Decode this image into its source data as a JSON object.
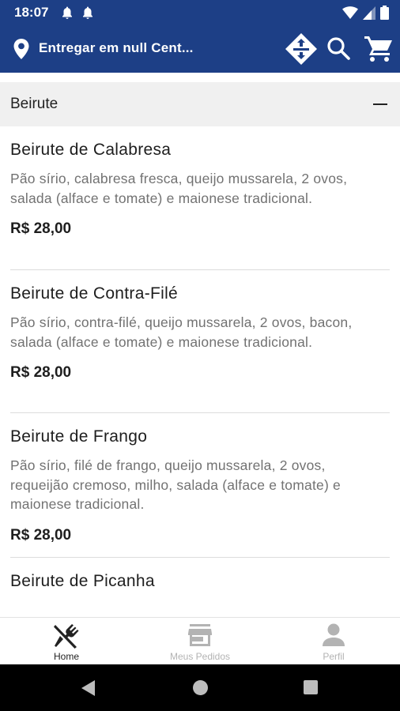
{
  "status_bar": {
    "time": "18:07",
    "icons": [
      "notification-bell-icon",
      "notification-bell-icon",
      "wifi-icon",
      "signal-icon",
      "battery-icon"
    ]
  },
  "app_bar": {
    "location_label": "Entregar em null Cent...",
    "icons": [
      "location-pin-icon",
      "route-directions-icon",
      "search-icon",
      "cart-icon"
    ],
    "background_color": "#1d3f86"
  },
  "category": {
    "title": "Beirute",
    "toggle": "collapse-minus-icon"
  },
  "menu_items": [
    {
      "name": "Beirute de Calabresa",
      "description": "Pão sírio, calabresa fresca, queijo mussarela, 2 ovos, salada (alface e tomate) e maionese tradicional.",
      "price": "R$ 28,00"
    },
    {
      "name": "Beirute de Contra-Filé",
      "description": "Pão sírio, contra-filé, queijo mussarela, 2 ovos, bacon, salada (alface e tomate) e maionese tradicional.",
      "price": "R$ 28,00"
    },
    {
      "name": "Beirute de Frango",
      "description": "Pão sírio, filé de frango, queijo mussarela, 2 ovos, requeijão cremoso, milho, salada (alface e tomate) e maionese tradicional.",
      "price": "R$ 28,00"
    },
    {
      "name": "Beirute de Picanha"
    }
  ],
  "bottom_nav": {
    "items": [
      {
        "label": "Home",
        "icon": "fork-knife-icon",
        "active": true
      },
      {
        "label": "Meus Pedidos",
        "icon": "store-icon",
        "active": false
      },
      {
        "label": "Perfil",
        "icon": "person-icon",
        "active": false
      }
    ],
    "active_color": "#222222",
    "inactive_color": "#b3b3b3"
  },
  "system_nav": {
    "icons": [
      "back-icon",
      "home-circle-icon",
      "recents-square-icon"
    ]
  }
}
